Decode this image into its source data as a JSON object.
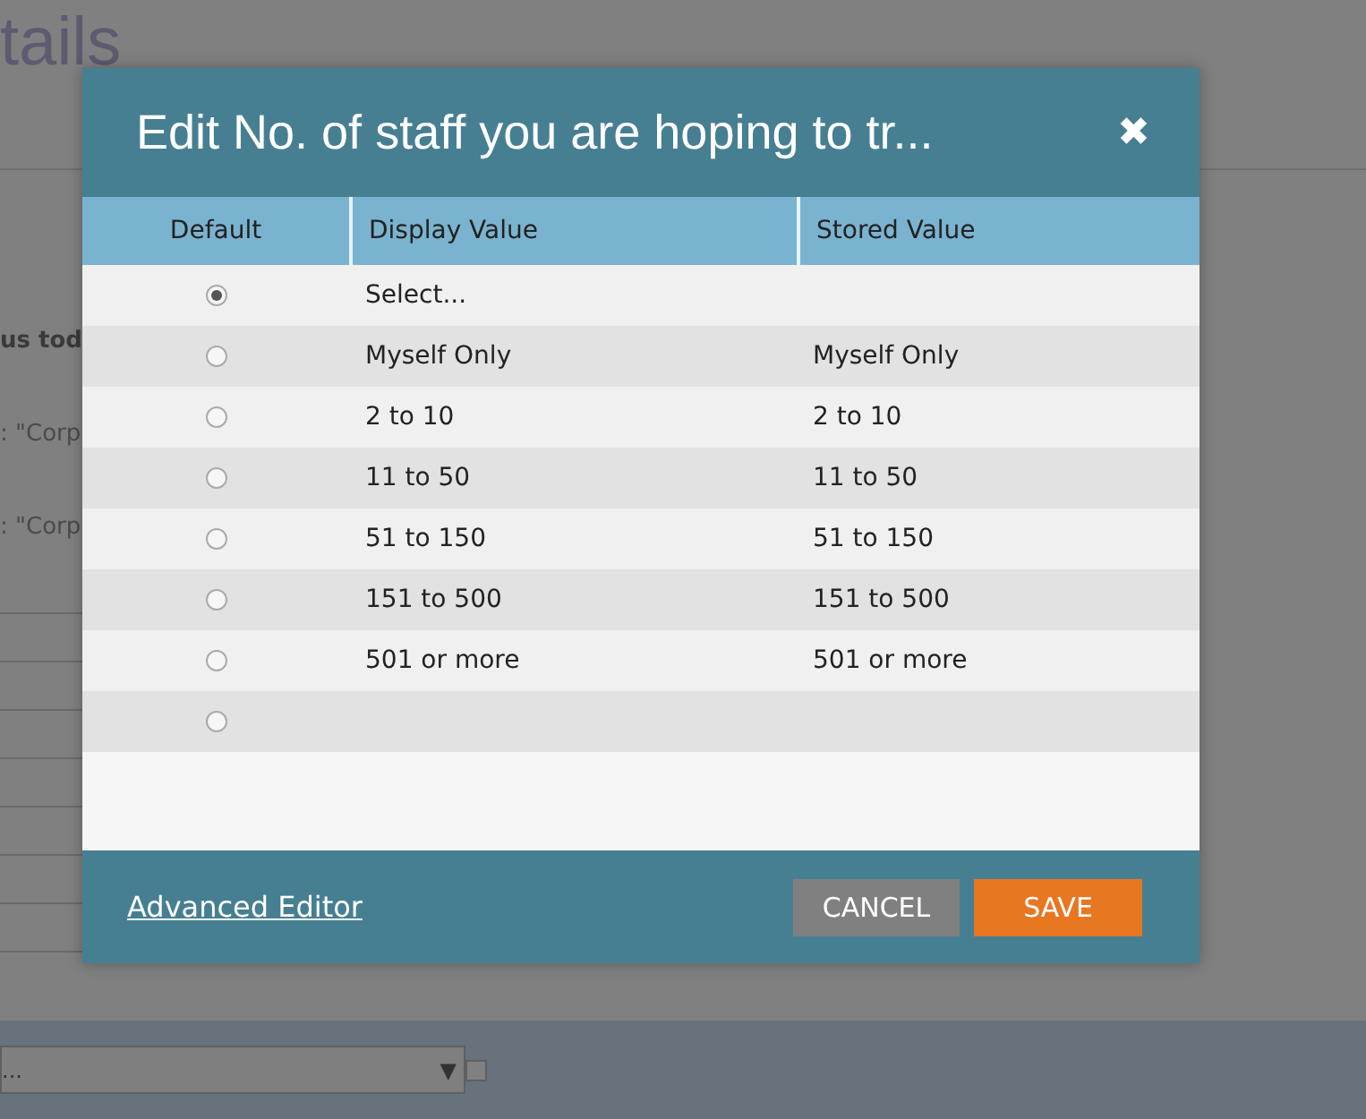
{
  "background": {
    "heading": "tails",
    "bold_text": "us tod",
    "lines": [
      ": \"Corp",
      ": \"Corp"
    ],
    "select": {
      "value": "...",
      "arrow": "▼"
    }
  },
  "dialog": {
    "title": "Edit No. of staff you are hoping to tr...",
    "close": "✖",
    "columns": [
      "Default",
      "Display Value",
      "Stored Value"
    ],
    "rows": [
      {
        "selected": true,
        "display": "Select..."
      },
      {
        "selected": false,
        "display": "Myself Only",
        "stored": "Myself Only"
      },
      {
        "selected": false,
        "display": "2 to 10",
        "stored": "2 to 10"
      },
      {
        "selected": false,
        "display": "11 to 50",
        "stored": "11 to 50"
      },
      {
        "selected": false,
        "display": "51 to 150",
        "stored": "51 to 150"
      },
      {
        "selected": false,
        "display": "151 to 500",
        "stored": "151 to 500"
      },
      {
        "selected": false,
        "display": "501 or more",
        "stored": "501 or more"
      },
      {
        "selected": false
      }
    ],
    "link": "Advanced Editor",
    "buttons": [
      {
        "kind": "cancel",
        "label": "CANCEL"
      },
      {
        "kind": "save",
        "label": "SAVE"
      }
    ]
  }
}
